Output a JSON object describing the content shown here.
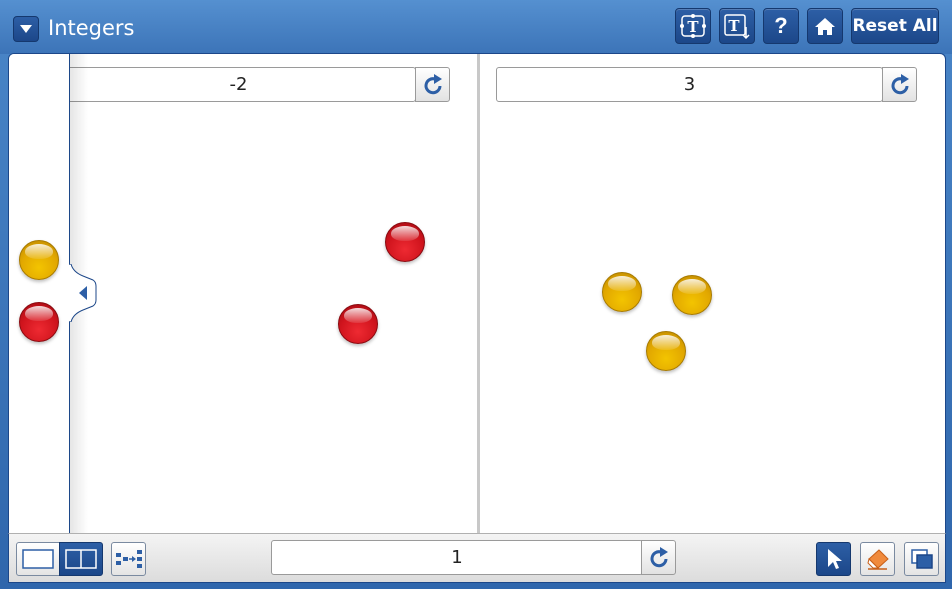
{
  "app": {
    "title": "Integers"
  },
  "toolbar": {
    "reset_label": "Reset All",
    "buttons": [
      "text-tool-icon",
      "text-answer-icon",
      "help-icon",
      "home-icon"
    ]
  },
  "left_panel": {
    "value": "-2"
  },
  "right_panel": {
    "value": "3"
  },
  "bottom": {
    "result_value": "1",
    "view_buttons": [
      "single-view-icon",
      "split-view-icon",
      "combine-icon"
    ],
    "tools": [
      "pointer-icon",
      "eraser-icon",
      "duplicate-icon"
    ]
  },
  "colors": {
    "positive_chip": "#e2a800",
    "negative_chip": "#d0141d",
    "brand_blue": "#2f66ac"
  }
}
